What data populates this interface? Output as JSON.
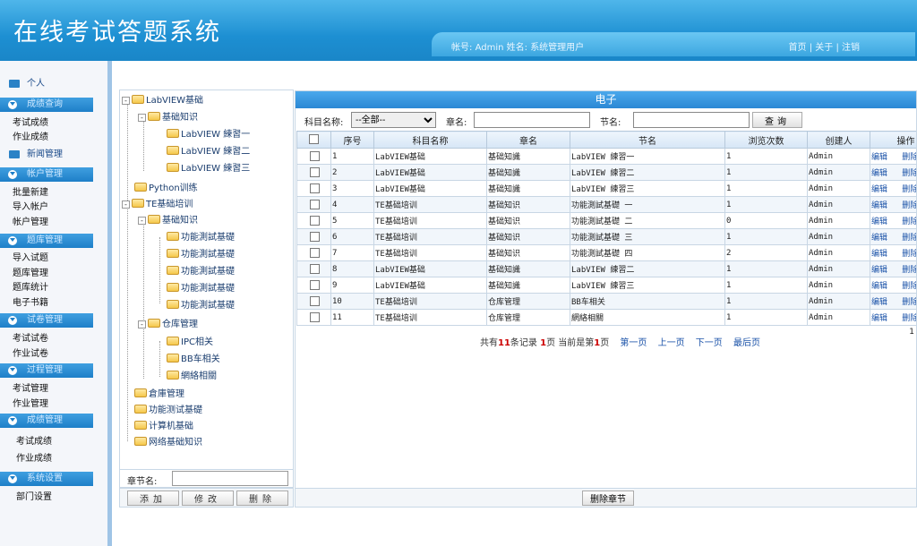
{
  "header": {
    "title": "在线考试答题系统",
    "account_label": "帐号:",
    "account": "Admin",
    "name_label": "姓名:",
    "name": "系统管理用户",
    "nav": [
      "首页",
      "关于",
      "注销"
    ],
    "sep": "|"
  },
  "sidebar": {
    "personal": "个人",
    "groups": [
      {
        "label": "成绩查询",
        "items": [
          "考试成绩",
          "作业成绩"
        ]
      },
      {
        "label": "新闻管理",
        "items": []
      },
      {
        "label": "帐户管理",
        "items": [
          "批量新建",
          "导入帐户",
          "帐户管理"
        ]
      },
      {
        "label": "题库管理",
        "items": [
          "导入试题",
          "题库管理",
          "题库统计",
          "电子书籍"
        ]
      },
      {
        "label": "试卷管理",
        "items": [
          "考试试卷",
          "作业试卷"
        ]
      },
      {
        "label": "过程管理",
        "items": [
          "考试管理",
          "作业管理"
        ]
      },
      {
        "label": "成绩管理",
        "items": [
          "考试成绩",
          "作业成绩"
        ]
      },
      {
        "label": "系统设置",
        "items": [
          "部门设置"
        ]
      }
    ]
  },
  "tree": {
    "nodes": [
      {
        "label": "LabVIEW基础"
      },
      {
        "label": "基础知识"
      },
      {
        "label": "LabVIEW 練習一"
      },
      {
        "label": "LabVIEW 練習二"
      },
      {
        "label": "LabVIEW 練習三"
      },
      {
        "label": "Python训练"
      },
      {
        "label": "TE基础培训"
      },
      {
        "label": "基础知识"
      },
      {
        "label": "功能測試基礎"
      },
      {
        "label": "功能測試基礎"
      },
      {
        "label": "功能測試基礎"
      },
      {
        "label": "功能測試基礎"
      },
      {
        "label": "功能測試基礎"
      },
      {
        "label": "仓库管理"
      },
      {
        "label": "IPC相关"
      },
      {
        "label": "BB车相关"
      },
      {
        "label": "網絡相關"
      },
      {
        "label": "倉庫管理"
      },
      {
        "label": "功能测试基礎"
      },
      {
        "label": "计算机基础"
      },
      {
        "label": "网络基础知识"
      }
    ],
    "chapter_label": "章节名:",
    "chapter_value": "",
    "buttons": [
      "添加",
      "修改",
      "删除"
    ]
  },
  "main": {
    "caption": "电子",
    "filter": {
      "subject_label": "科目名称:",
      "subject_value": "--全部--",
      "chapter_label": "章名:",
      "section_label": "节名:",
      "search": "查询"
    },
    "columns": [
      "序号",
      "科目名称",
      "章名",
      "节名",
      "浏览次数",
      "创建人",
      "操作"
    ],
    "rows": [
      [
        "1",
        "LabVIEW基础",
        "基础知識",
        "LabVIEW 練習一",
        "1",
        "Admin",
        "编辑",
        "删除"
      ],
      [
        "2",
        "LabVIEW基础",
        "基础知識",
        "LabVIEW 練習二",
        "1",
        "Admin",
        "编辑",
        "删除"
      ],
      [
        "3",
        "LabVIEW基础",
        "基础知識",
        "LabVIEW 練習三",
        "1",
        "Admin",
        "编辑",
        "删除"
      ],
      [
        "4",
        "TE基础培训",
        "基础知识",
        "功能測試基礎 一",
        "1",
        "Admin",
        "编辑",
        "删除"
      ],
      [
        "5",
        "TE基础培训",
        "基础知识",
        "功能測試基礎 二",
        "0",
        "Admin",
        "编辑",
        "删除"
      ],
      [
        "6",
        "TE基础培训",
        "基础知识",
        "功能測試基礎 三",
        "1",
        "Admin",
        "编辑",
        "删除"
      ],
      [
        "7",
        "TE基础培训",
        "基础知识",
        "功能測試基礎 四",
        "2",
        "Admin",
        "编辑",
        "删除"
      ],
      [
        "8",
        "LabVIEW基础",
        "基础知識",
        "LabVIEW 練習二",
        "1",
        "Admin",
        "编辑",
        "删除"
      ],
      [
        "9",
        "LabVIEW基础",
        "基础知識",
        "LabVIEW 練習三",
        "1",
        "Admin",
        "编辑",
        "删除"
      ],
      [
        "10",
        "TE基础培训",
        "仓库管理",
        "BB车相关",
        "1",
        "Admin",
        "编辑",
        "删除"
      ],
      [
        "11",
        "TE基础培训",
        "仓库管理",
        "網絡相關",
        "1",
        "Admin",
        "编辑",
        "删除"
      ]
    ],
    "pager": {
      "total_pre": "共有",
      "total": "11",
      "total_post": "条记录",
      "pages": "1",
      "pages_post": "页 当前是第",
      "cur": "1",
      "cur_post": "页",
      "links": [
        "第一页",
        "上一页",
        "下一页",
        "最后页"
      ],
      "right": "1"
    },
    "delete_chapter": "删除章节"
  }
}
